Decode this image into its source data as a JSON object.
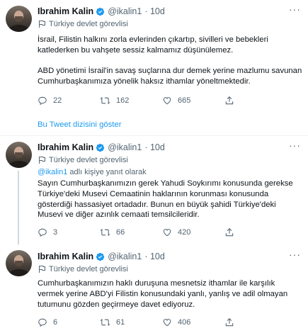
{
  "colors": {
    "accent": "#1d9bf0",
    "secondary": "#536471",
    "text": "#0f1419",
    "border": "#eff3f4"
  },
  "show_thread": "Bu Tweet dizisini göster",
  "tweets": [
    {
      "name": "Ibrahim Kalin",
      "handle": "@ikalin1",
      "time": "· 10d",
      "label": "Türkiye devlet görevlisi",
      "replying_to": "",
      "replying_suffix": "",
      "text": "İsrail, Filistin halkını zorla evlerinden çıkartıp, sivilleri ve bebekleri katlederken bu vahşete sessiz kalmamız düşünülemez.\n\nABD yönetimi İsrail'in savaş suçlarına dur demek yerine mazlumu savunan Cumhurbaşkanımıza yönelik haksız ithamlar yöneltmektedir.",
      "replies": "22",
      "retweets": "162",
      "likes": "665"
    },
    {
      "name": "Ibrahim Kalin",
      "handle": "@ikalin1",
      "time": "· 10d",
      "label": "Türkiye devlet görevlisi",
      "replying_to": "@ikalin1",
      "replying_suffix": " adlı kişiye yanıt olarak",
      "text": "Sayın Cumhurbaşkanımızın gerek Yahudi Soykırımı konusunda gerekse Türkiye'deki Musevi Cemaatinin haklarının korunması konusunda gösterdiği hassasiyet ortadadır. Bunun en büyük şahidi Türkiye'deki Musevi ve diğer azınlık cemaati temsilcileridir.",
      "replies": "3",
      "retweets": "66",
      "likes": "420"
    },
    {
      "name": "Ibrahim Kalin",
      "handle": "@ikalin1",
      "time": "· 10d",
      "label": "Türkiye devlet görevlisi",
      "replying_to": "",
      "replying_suffix": "",
      "text": "Cumhurbaşkanımızın haklı duruşuna mesnetsiz ithamlar ile karşılık vermek yerine ABD'yi Filistin konusundaki yanlı, yanlış ve adil olmayan tutumunu gözden geçirmeye davet ediyoruz.",
      "replies": "6",
      "retweets": "61",
      "likes": "406"
    }
  ]
}
